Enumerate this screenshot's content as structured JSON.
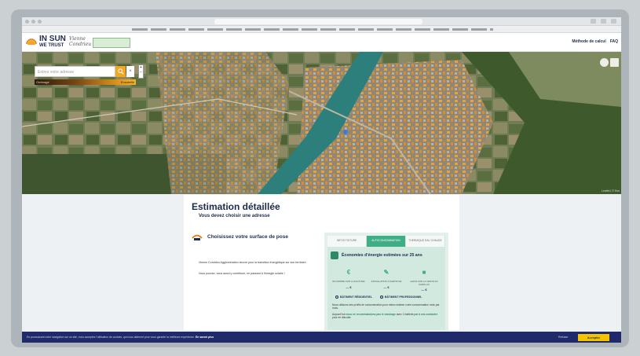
{
  "browser": {
    "url": ""
  },
  "header": {
    "logo_line1": "IN SUN",
    "logo_line2": "WE TRUST",
    "partner_line1": "Vienne",
    "partner_line2": "Condrieu",
    "nav": [
      "Méthode de calcul",
      "FAQ"
    ]
  },
  "map": {
    "search_placeholder": "Entrez votre adresse",
    "search_icon": "search-icon",
    "clear_label": "×",
    "zoom_in": "+",
    "zoom_out": "−",
    "legend_low": "Ombragé",
    "legend_high": "Ensoleillé",
    "attribution": "Leaflet | © Esri"
  },
  "content": {
    "title": "Estimation détaillée",
    "subtitle": "Vous devez choisir une adresse",
    "step_label": "Choisissez votre surface de pose",
    "para1": "Vienne Condrieu Agglomération œuvre pour la transition énergétique sur son territoire.",
    "para2": "Vous pouvez, vous aussi y contribuer, en passant à l'énergie solaire !"
  },
  "estimation": {
    "tabs": [
      {
        "label": "INFOS TOITURE",
        "active": false
      },
      {
        "label": "AUTOCONSOMMATION",
        "active": true
      },
      {
        "label": "THERMIQUE EAU CHAUDE",
        "active": false
      }
    ],
    "title": "Économies d'énergie estimées sur 25 ans",
    "columns": [
      {
        "icon": "euro-icon",
        "label": "ÉCONOMIE SUR LA FACTURE",
        "value": "--- €"
      },
      {
        "icon": "tools-icon",
        "label": "INSTALLATION À PARTIR DE",
        "value": "--- €"
      },
      {
        "icon": "grant-icon",
        "label": "GAINS SUR LA VENTE DU SURPLUS",
        "value": "--- €"
      }
    ],
    "radios": [
      "BÂTIMENT RÉSIDENTIEL",
      "BÂTIMENT PROFESSIONNEL"
    ],
    "text1": "Nous utilisons des profils de consommation pour mieux estimer votre consommation mois par mois.",
    "text2_prefix": "Aujourd'hui",
    "text2_highlight": "nous ne recommandons pas le stockage",
    "text2_rest": "avec 1 batterie par",
    "text3_link": "à vos contacter",
    "text3_rest": "pour en discuter."
  },
  "cookie": {
    "text": "En poursuivant votre navigation sur ce site, vous acceptez l'utilisation de cookies, qui nous aideront pour vous garantir la meilleure expérience.",
    "link": "En savoir plus",
    "refuse": "Refuser",
    "accept": "Accepter"
  },
  "colors": {
    "brand_navy": "#1d2c4d",
    "accent_orange": "#f4a623",
    "estimate_green": "#3fae87",
    "cookie_bg": "#1f2a6b",
    "accept_yellow": "#f4c400"
  }
}
